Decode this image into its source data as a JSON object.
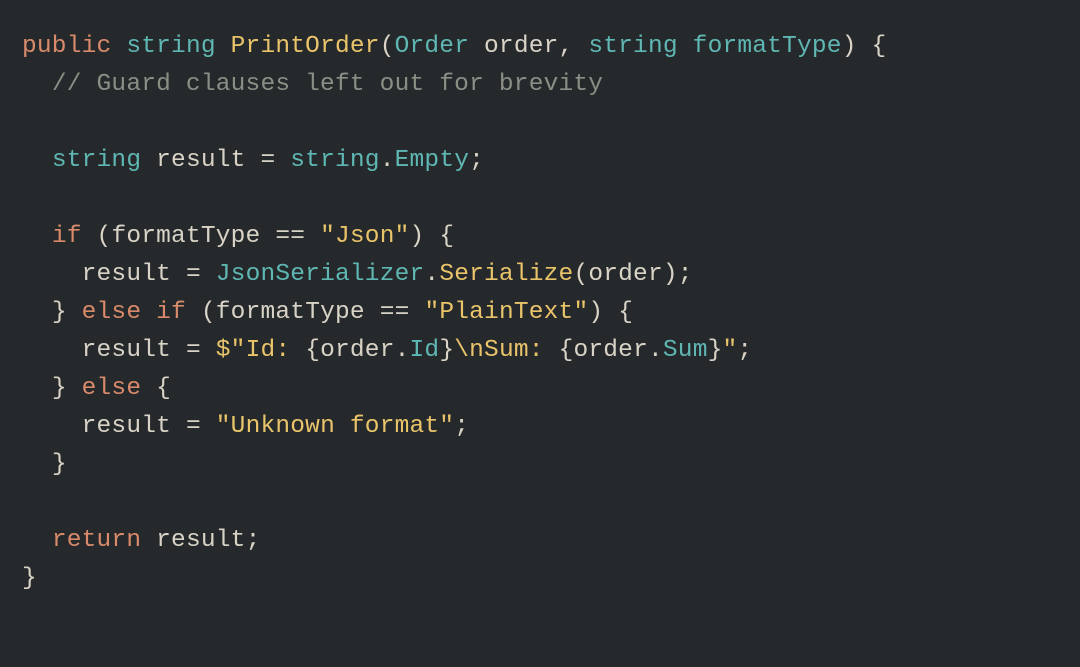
{
  "tokens": {
    "kw_public": "public",
    "kw_if": "if",
    "kw_else": "else",
    "kw_return": "return",
    "type_string": "string",
    "type_Order": "Order",
    "fn_PrintOrder": "PrintOrder",
    "fn_Serialize": "Serialize",
    "var_order": "order",
    "var_formatType": "formatType",
    "var_result": "result",
    "prop_Empty": "Empty",
    "prop_JsonSerializer": "JsonSerializer",
    "prop_Id": "Id",
    "prop_Sum": "Sum",
    "comment_brevity": "// Guard clauses left out for brevity",
    "str_Json": "\"Json\"",
    "str_PlainText": "\"PlainText\"",
    "str_unknown": "\"Unknown format\"",
    "str_interp_prefix": "$\"Id: ",
    "str_interp_mid": "\\nSum: ",
    "str_interp_suffix": "\"",
    "brace_open": "{",
    "brace_close": "}",
    "paren_open": "(",
    "paren_close": ")",
    "semicolon": ";",
    "comma": ", ",
    "dot": ".",
    "assign": " = ",
    "eqeq": " == "
  }
}
